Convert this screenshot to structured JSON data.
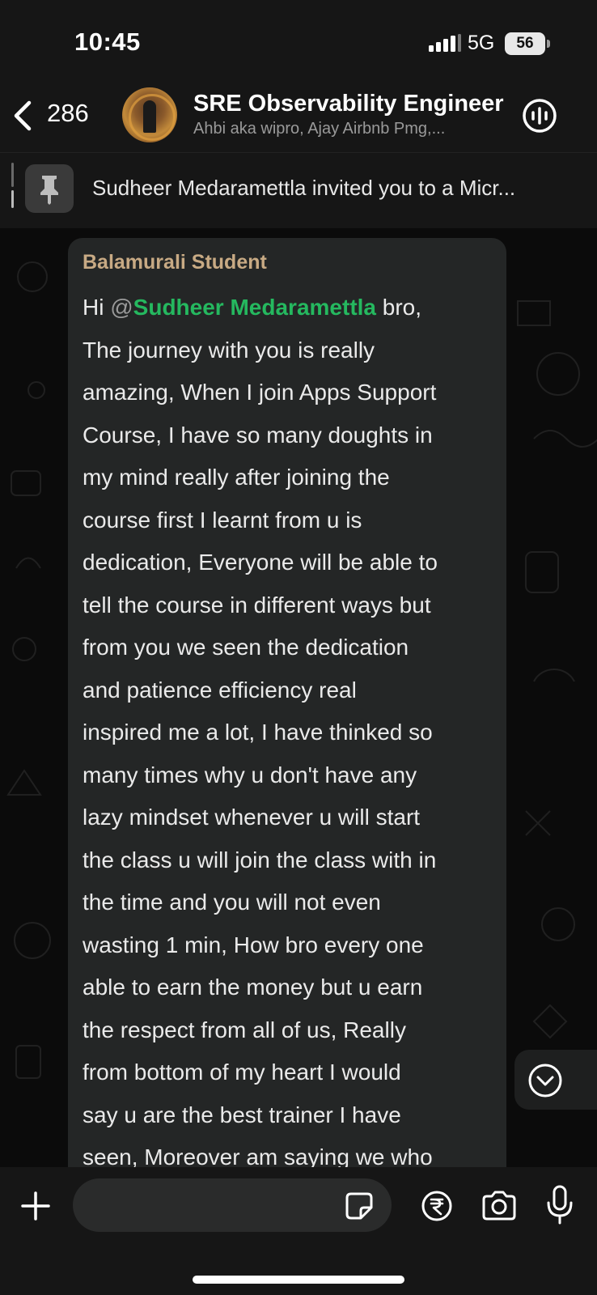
{
  "status_bar": {
    "time": "10:45",
    "network": "5G",
    "battery": "56"
  },
  "header": {
    "back_count": "286",
    "title": "SRE Observability Engineer",
    "subtitle": "Ahbi aka wipro, Ajay Airbnb Pmg,..."
  },
  "pinned": {
    "text": "Sudheer Medaramettla invited you to a Micr..."
  },
  "message": {
    "sender": "Balamurali Student",
    "greeting": "Hi ",
    "mention_at": "@",
    "mention_name": "Sudheer Medaramettla",
    "after_mention": "  bro,",
    "body": "The journey with you is really\namazing, When I join Apps Support\nCourse, I have so many doughts in\nmy mind really after joining the\ncourse first I learnt from u is\ndedication, Everyone will be able to\ntell the course in different ways but\nfrom you we seen the dedication\nand patience efficiency real\ninspired me a lot, I have thinked so\nmany times why u don't have any\nlazy mindset whenever u will start\nthe class u will join the class with in\nthe time and you will not even\nwasting 1 min, How bro every one\nable to earn the money but u earn\nthe respect from all of us, Really\nfrom bottom of my heart I would\nsay u are the best trainer I have\nseen, Moreover am saying we who"
  },
  "colors": {
    "sender": "#c8aa84",
    "mention": "#25b85f",
    "bubble": "#242626"
  }
}
